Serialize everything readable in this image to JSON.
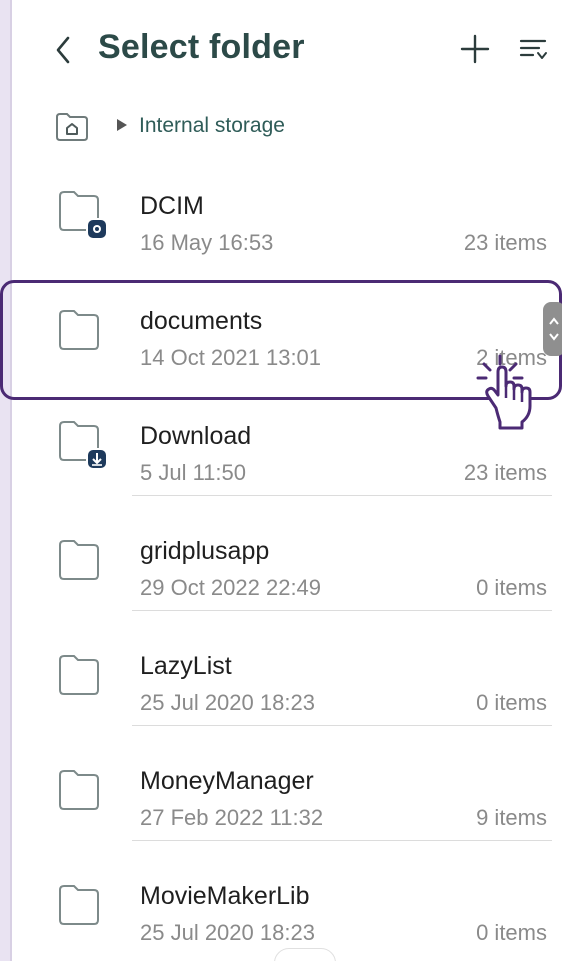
{
  "header": {
    "title": "Select folder",
    "back_icon": "chevron-left-icon",
    "add_icon": "plus-icon",
    "sort_icon": "sort-list-icon"
  },
  "breadcrumb": {
    "home_icon": "home-folder-icon",
    "separator_icon": "triangle-right-icon",
    "label": "Internal storage"
  },
  "folders": [
    {
      "name": "DCIM",
      "date": "16 May 16:53",
      "count": "23 items",
      "badge": "camera"
    },
    {
      "name": "documents",
      "date": "14 Oct 2021 13:01",
      "count": "2 items",
      "badge": ""
    },
    {
      "name": "Download",
      "date": "5 Jul 11:50",
      "count": "23 items",
      "badge": "download"
    },
    {
      "name": "gridplusapp",
      "date": "29 Oct 2022 22:49",
      "count": "0 items",
      "badge": ""
    },
    {
      "name": "LazyList",
      "date": "25 Jul 2020 18:23",
      "count": "0 items",
      "badge": ""
    },
    {
      "name": "MoneyManager",
      "date": "27 Feb 2022 11:32",
      "count": "9 items",
      "badge": ""
    },
    {
      "name": "MovieMakerLib",
      "date": "25 Jul 2020 18:23",
      "count": "0 items",
      "badge": ""
    }
  ],
  "colors": {
    "title": "#2c4a48",
    "highlight": "#4b2a74",
    "folder_outline": "#7d8a8a",
    "badge": "#1e3a5c"
  }
}
